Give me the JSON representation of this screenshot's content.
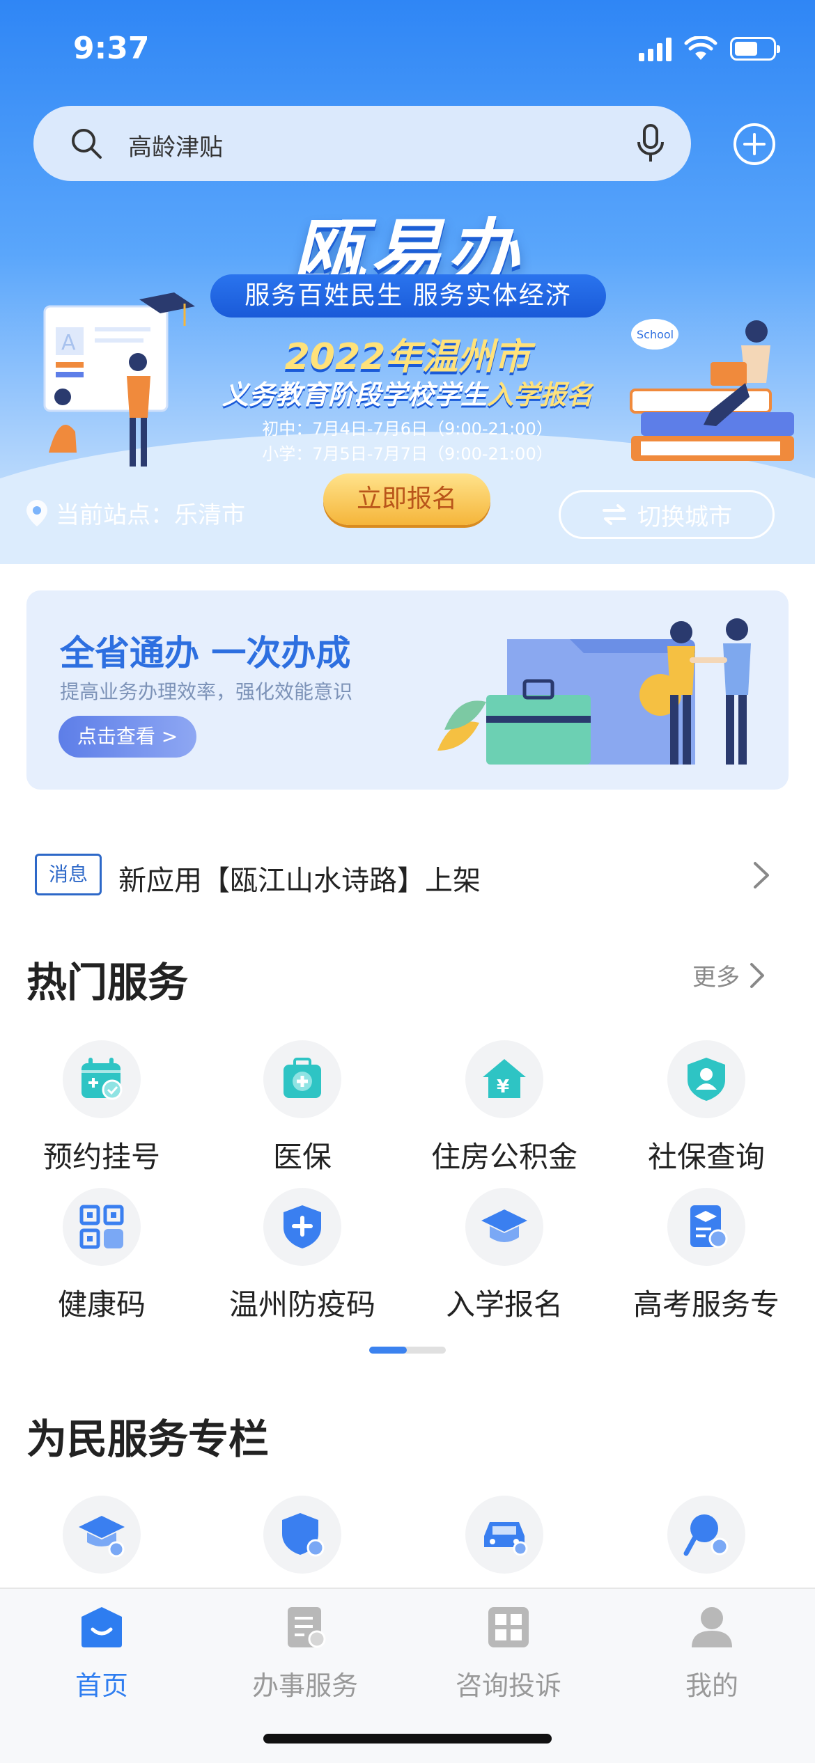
{
  "status_bar": {
    "time": "9:37",
    "battery_level": 0.62
  },
  "search": {
    "placeholder": "高龄津贴"
  },
  "banner": {
    "brand": "瓯易办",
    "slogan": "服务百姓民生   服务实体经济",
    "event_year_city": "2022年温州市",
    "event_prefix": "义务教育阶段学校学生",
    "event_highlight": "入学报名",
    "date_junior": "初中：7月4日-7月6日（9:00-21:00）",
    "date_primary": "小学：7月5日-7月7日（9:00-21:00）",
    "register_label": "立即报名",
    "illus_label": "School"
  },
  "location": {
    "label": "当前站点：乐清市",
    "switch_label": "切换城市"
  },
  "promo": {
    "title": "全省通办 一次办成",
    "subtitle": "提高业务办理效率，强化效能意识",
    "button": "点击查看 >"
  },
  "notice": {
    "tag": "消息",
    "text": "新应用【瓯江山水诗路】上架"
  },
  "hot_services": {
    "title": "热门服务",
    "more": "更多",
    "items": [
      {
        "label": "预约挂号",
        "icon": "calendar-add-icon"
      },
      {
        "label": "医保",
        "icon": "medical-kit-icon"
      },
      {
        "label": "住房公积金",
        "icon": "house-fund-icon"
      },
      {
        "label": "社保查询",
        "icon": "social-security-icon"
      },
      {
        "label": "健康码",
        "icon": "qr-code-icon"
      },
      {
        "label": "温州防疫码",
        "icon": "shield-plus-icon"
      },
      {
        "label": "入学报名",
        "icon": "graduation-cap-icon"
      },
      {
        "label": "高考服务专",
        "icon": "exam-doc-icon"
      }
    ],
    "page_index": 1,
    "page_count": 2
  },
  "citizen_services": {
    "title": "为民服务专栏",
    "items": [
      {
        "icon": "graduation-cap-icon"
      },
      {
        "icon": "insurance-icon"
      },
      {
        "icon": "car-icon"
      },
      {
        "icon": "sports-icon"
      }
    ]
  },
  "tabbar": {
    "tabs": [
      {
        "label": "首页",
        "icon": "home-icon",
        "active": true
      },
      {
        "label": "办事服务",
        "icon": "document-icon",
        "active": false
      },
      {
        "label": "咨询投诉",
        "icon": "consult-icon",
        "active": false
      },
      {
        "label": "我的",
        "icon": "user-icon",
        "active": false
      }
    ]
  },
  "colors": {
    "primary": "#2e7df0",
    "hero_top": "#2f86f5",
    "accent_gold": "#f5b53a"
  }
}
